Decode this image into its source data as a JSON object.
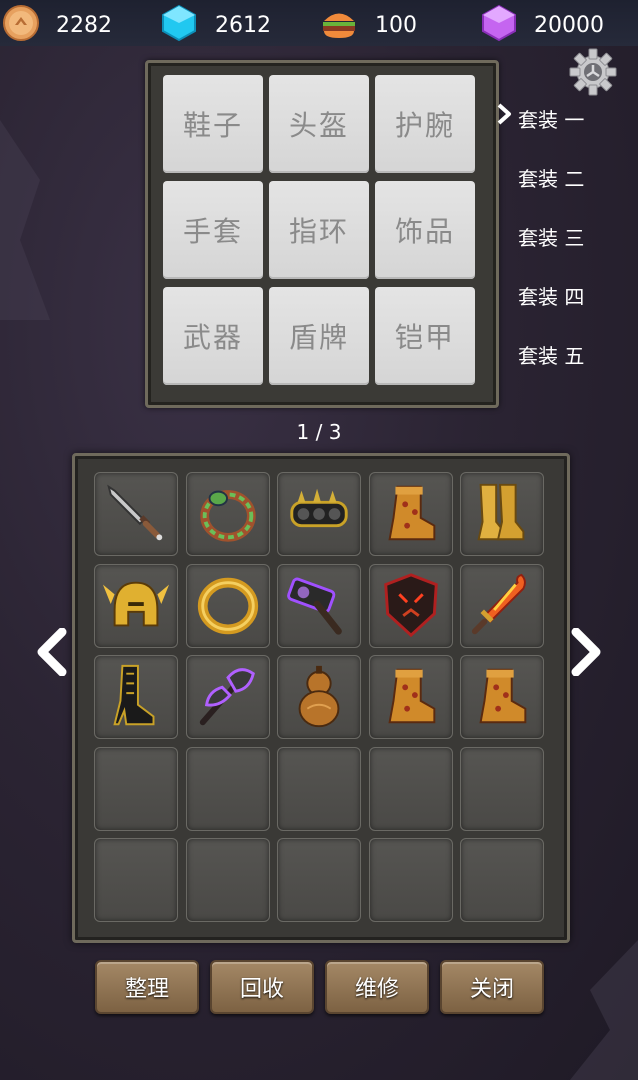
{
  "resources": [
    {
      "name": "gold-coin-icon",
      "value": "2282"
    },
    {
      "name": "blue-gem-icon",
      "value": "2612"
    },
    {
      "name": "burger-icon",
      "value": "100"
    },
    {
      "name": "purple-gem-icon",
      "value": "20000"
    }
  ],
  "equip_slots": [
    "鞋子",
    "头盔",
    "护腕",
    "手套",
    "指环",
    "饰品",
    "武器",
    "盾牌",
    "铠甲"
  ],
  "suits": [
    "套装 一",
    "套装 二",
    "套装 三",
    "套装 四",
    "套装 五"
  ],
  "selected_suit": 0,
  "page_indicator": "1 / 3",
  "inventory": [
    "dagger-icon",
    "snake-ring-icon",
    "spiked-knuckles-icon",
    "red-boot-icon",
    "gold-greaves-icon",
    "gold-helmet-icon",
    "gold-ring-icon",
    "purple-hammer-icon",
    "demon-shield-icon",
    "flame-sword-icon",
    "black-heel-boot-icon",
    "purple-axe-icon",
    "gourd-icon",
    "red-boot-icon",
    "red-boot-icon",
    "",
    "",
    "",
    "",
    "",
    "",
    "",
    "",
    "",
    ""
  ],
  "buttons": {
    "sort": "整理",
    "recycle": "回收",
    "repair": "维修",
    "close": "关闭"
  },
  "colors": {
    "panel": "#3b3a36",
    "slot": "#e0e0e0",
    "button": "#8f7453"
  }
}
